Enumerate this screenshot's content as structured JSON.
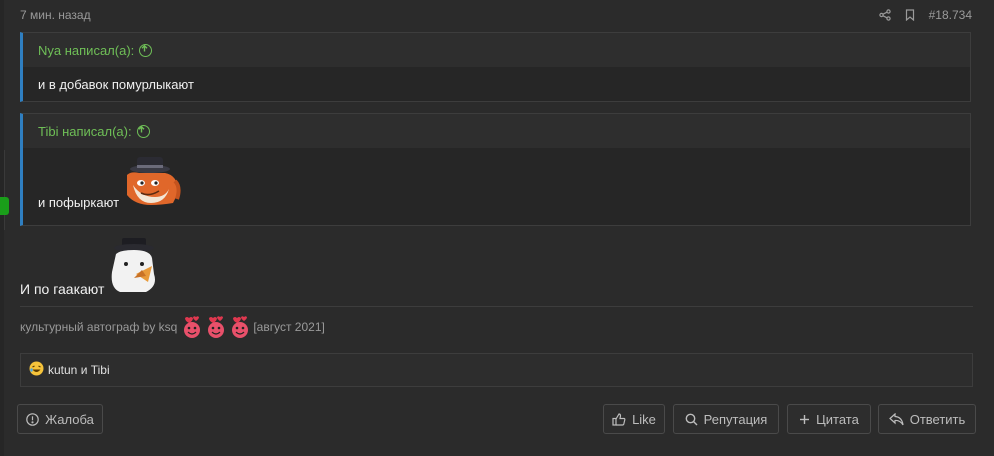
{
  "post": {
    "time": "7 мин. назад",
    "number": "#18.734"
  },
  "quotes": [
    {
      "author": "Nya написал(а):",
      "text": "и в добавок помурлыкают"
    },
    {
      "author": "Tibi написал(а):",
      "text": "и пофыркают"
    }
  ],
  "message": {
    "text": "И по гаакают"
  },
  "signature": {
    "text": "культурный автограф by ksq",
    "date": "[август 2021]"
  },
  "reactions": {
    "emoji_icon": "laughing-emoji-icon",
    "text": "kutun и Tibi"
  },
  "buttons": {
    "report": "Жалоба",
    "like": "Like",
    "reputation": "Репутация",
    "quote": "Цитата",
    "reply": "Ответить"
  },
  "colors": {
    "background": "#2b2b2b",
    "quote_author": "#6fbf57",
    "quote_border": "#2f7fc1",
    "online": "#1a9e1a"
  }
}
